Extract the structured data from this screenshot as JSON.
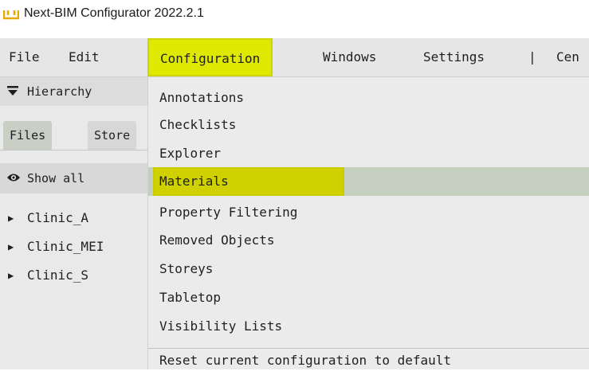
{
  "window": {
    "title": "Next-BIM Configurator 2022.2.1",
    "icon": "app-logo-icon"
  },
  "menubar": {
    "items": [
      {
        "label": "File"
      },
      {
        "label": "Edit"
      },
      {
        "label": "Configuration"
      },
      {
        "label": "Windows"
      },
      {
        "label": "Settings"
      },
      {
        "label": "|"
      },
      {
        "label": "Cen"
      }
    ],
    "active_color": "#dfe800"
  },
  "left_panel": {
    "hierarchy_label": "Hierarchy",
    "tabs": [
      {
        "label": "Files"
      },
      {
        "label": "Store"
      }
    ],
    "show_all_label": "Show all",
    "tree": [
      {
        "name": "Clinic_A"
      },
      {
        "name": "Clinic_MEI"
      },
      {
        "name": "Clinic_S"
      }
    ]
  },
  "dropdown": {
    "items": [
      {
        "label": "Annotations"
      },
      {
        "label": "Checklists"
      },
      {
        "label": "Explorer"
      },
      {
        "label": "Materials"
      },
      {
        "label": "Property Filtering"
      },
      {
        "label": "Removed Objects"
      },
      {
        "label": "Storeys"
      },
      {
        "label": "Tabletop"
      },
      {
        "label": "Visibility Lists"
      }
    ],
    "hovered_item": "Materials",
    "footer_item": {
      "label": "Reset current configuration to default"
    }
  }
}
